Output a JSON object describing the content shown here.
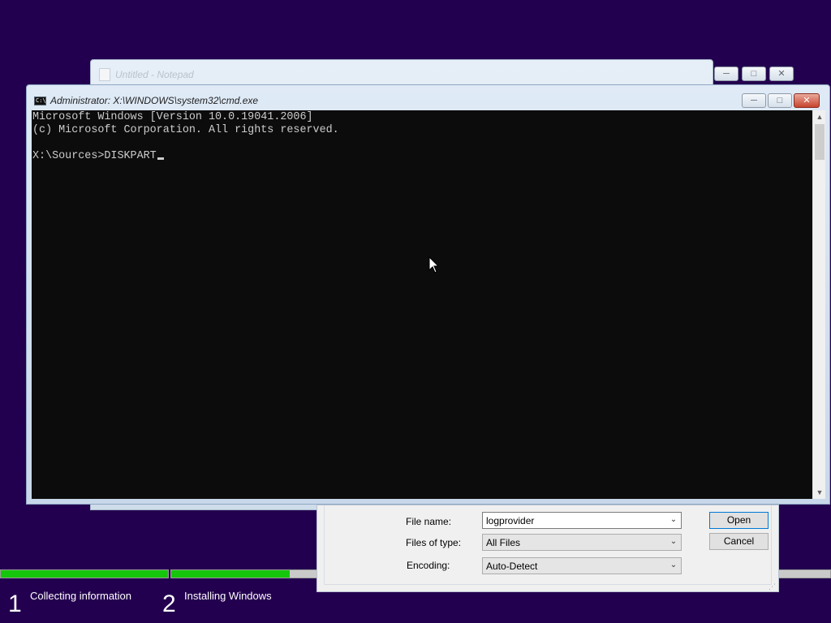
{
  "colors": {
    "desktop": "#23004f",
    "progress_fill": "#16c60c",
    "console_bg": "#0c0c0c",
    "console_text": "#cccccc"
  },
  "setup": {
    "steps": [
      {
        "number": "1",
        "label": "Collecting information",
        "progress": 1.0
      },
      {
        "number": "2",
        "label": "Installing Windows",
        "progress": 0.18
      }
    ]
  },
  "notepad": {
    "title": "Untitled - Notepad",
    "icon": "notepad-icon",
    "buttons": {
      "minimize": "minimize-icon",
      "maximize": "maximize-icon",
      "close": "close-icon"
    }
  },
  "cmd": {
    "title": "Administrator: X:\\WINDOWS\\system32\\cmd.exe",
    "icon": "cmd-icon",
    "icon_text": "C:\\",
    "lines": [
      "Microsoft Windows [Version 10.0.19041.2006]",
      "(c) Microsoft Corporation. All rights reserved.",
      "",
      "X:\\Sources>DISKPART"
    ]
  },
  "open_dialog": {
    "file_name_label": "File name:",
    "file_name_value": "logprovider",
    "files_of_type_label": "Files of type:",
    "files_of_type_value": "All Files",
    "encoding_label": "Encoding:",
    "encoding_value": "Auto-Detect",
    "open_button": "Open",
    "cancel_button": "Cancel"
  }
}
